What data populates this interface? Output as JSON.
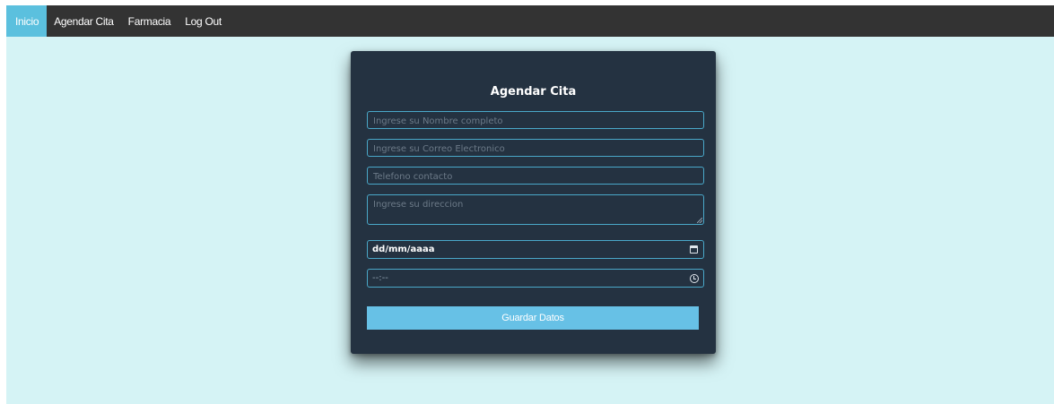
{
  "nav": {
    "items": [
      {
        "label": "Inicio",
        "active": true
      },
      {
        "label": "Agendar Cita",
        "active": false
      },
      {
        "label": "Farmacia",
        "active": false
      },
      {
        "label": "Log Out",
        "active": false
      }
    ]
  },
  "form": {
    "title": "Agendar Cita",
    "name_placeholder": "Ingrese su Nombre completo",
    "email_placeholder": "Ingrese su Correo Electronico",
    "phone_placeholder": "Telefono contacto",
    "address_placeholder": "Ingrese su direccion",
    "date_value": "dd/mm/aaaa",
    "time_value": "--:--",
    "submit_label": "Guardar Datos"
  },
  "icons": {
    "date": "calendar-icon",
    "time": "clock-icon"
  },
  "colors": {
    "navbar": "#333333",
    "nav_active": "#5bc0de",
    "page_background": "#d5f3f5",
    "card_background": "#243241",
    "field_border": "#4aa8c9",
    "button": "#67c1e6"
  }
}
